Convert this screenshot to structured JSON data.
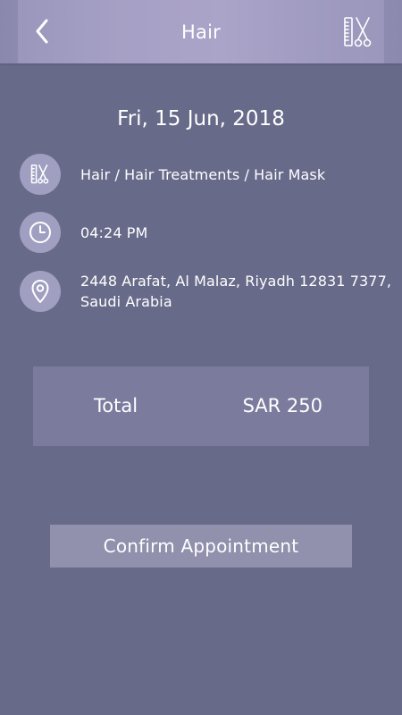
{
  "header": {
    "title": "Hair",
    "back_icon": "chevron-left-icon",
    "tool_icon": "comb-scissors-icon"
  },
  "appointment": {
    "date": "Fri, 15 Jun, 2018",
    "service": "Hair / Hair Treatments / Hair Mask",
    "time": "04:24 PM",
    "address_line1": "2448 Arafat, Al Malaz, Riyadh 12831 7377,",
    "address_line2": "Saudi Arabia"
  },
  "icons": {
    "service": "comb-scissors-icon",
    "time": "clock-icon",
    "location": "location-pin-icon"
  },
  "total": {
    "label": "Total",
    "value": "SAR 250"
  },
  "confirm": {
    "label": "Confirm Appointment"
  },
  "colors": {
    "background": "#686a89",
    "icon_circle": "#a09fc1",
    "total_box": "#7b7b9e",
    "button": "#9190ad",
    "text": "#ffffff"
  }
}
